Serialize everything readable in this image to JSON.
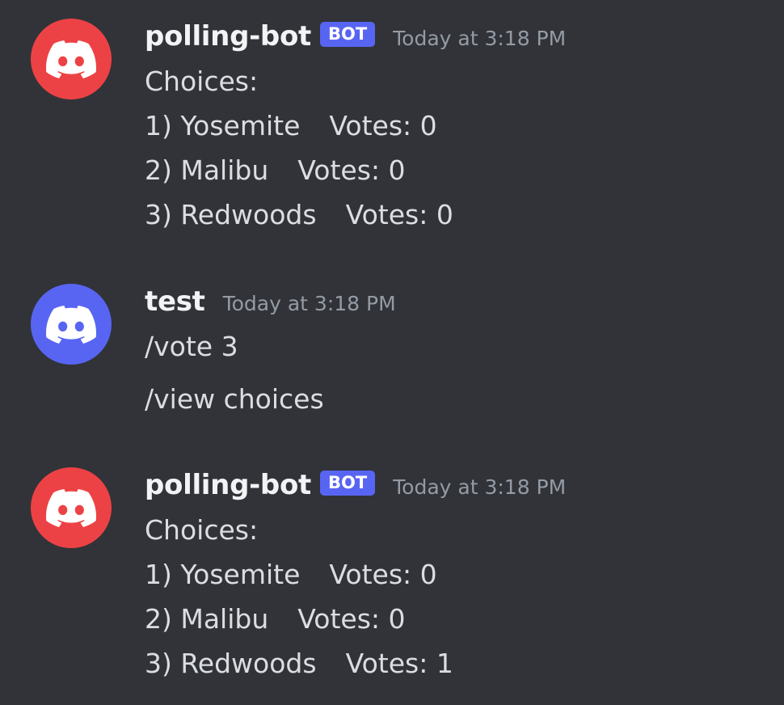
{
  "colors": {
    "background": "#313338",
    "bot_avatar": "#ed4245",
    "user_avatar": "#5865f2",
    "bot_tag": "#5865f2",
    "timestamp": "#949ba4"
  },
  "messages": [
    {
      "author": "polling-bot",
      "badge": "BOT",
      "timestamp": "Today at 3:18 PM",
      "avatar_icon": "discord-logo-icon",
      "lines": [
        "Choices:",
        "1) Yosemite",
        "Votes: 0",
        "2) Malibu",
        "Votes: 0",
        "3) Redwoods",
        "Votes: 0"
      ]
    },
    {
      "author": "test",
      "timestamp": "Today at 3:18 PM",
      "avatar_icon": "discord-logo-icon",
      "lines": [
        "/vote 3",
        "/view choices"
      ]
    },
    {
      "author": "polling-bot",
      "badge": "BOT",
      "timestamp": "Today at 3:18 PM",
      "avatar_icon": "discord-logo-icon",
      "lines": [
        "Choices:",
        "1) Yosemite",
        "Votes: 0",
        "2) Malibu",
        "Votes: 0",
        "3) Redwoods",
        "Votes: 1"
      ]
    }
  ]
}
